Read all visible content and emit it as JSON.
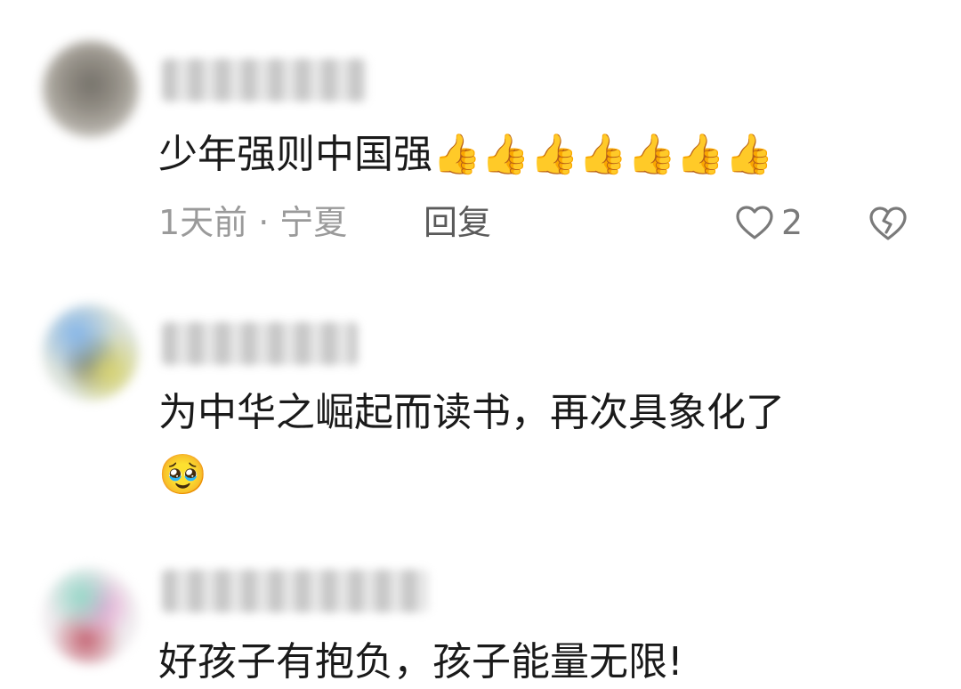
{
  "comments": [
    {
      "text": "少年强则中国强",
      "emoji": "👍👍👍👍👍👍👍",
      "time": "1天前",
      "separator": "·",
      "location": "宁夏",
      "reply_label": "回复",
      "like_count": "2",
      "like_icon": "heart-outline-icon",
      "dislike_icon": "broken-heart-icon"
    },
    {
      "text": "为中华之崛起而读书，再次具象化了",
      "emoji": "🥹"
    },
    {
      "text": "好孩子有抱负，孩子能量无限!"
    }
  ],
  "colors": {
    "primary_text": "#1a1a1a",
    "meta_text": "#9a9a9a",
    "reply_text": "#5a5a5a",
    "icon_gray": "#7a7a7a"
  }
}
